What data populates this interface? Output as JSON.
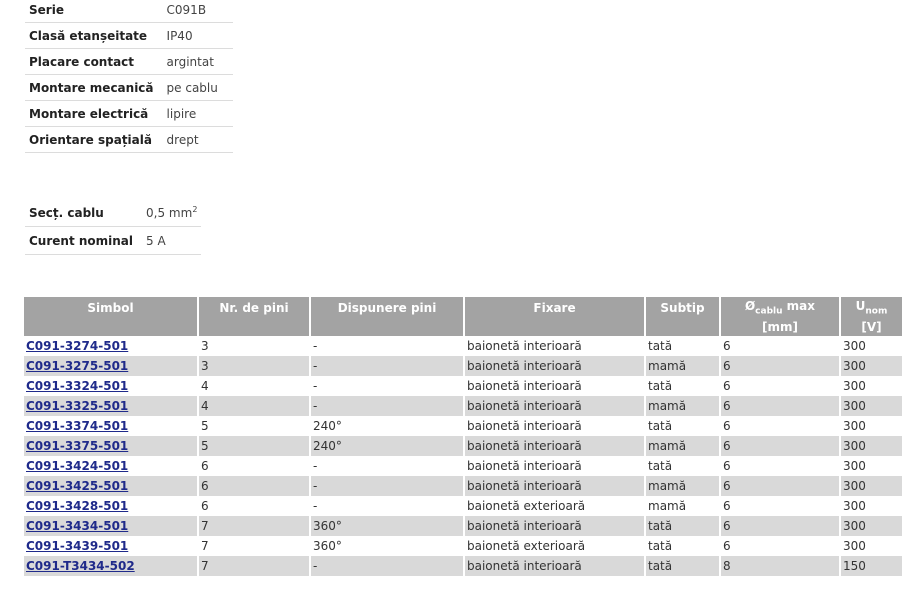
{
  "specs": [
    {
      "label": "Serie",
      "value": "C091B"
    },
    {
      "label": "Clasă etanșeitate",
      "value": "IP40"
    },
    {
      "label": "Placare contact",
      "value": "argintat"
    },
    {
      "label": "Montare mecanică",
      "value": "pe cablu"
    },
    {
      "label": "Montare electrică",
      "value": "lipire"
    },
    {
      "label": "Orientare spațială",
      "value": "drept"
    }
  ],
  "cable": {
    "section_label": "Secț. cablu",
    "section_value": "0,5 mm",
    "section_exp": "2",
    "current_label": "Curent nominal",
    "current_value": "5 A"
  },
  "table": {
    "headers": {
      "simbol": "Simbol",
      "pini": "Nr. de pini",
      "dispunere": "Dispunere pini",
      "fixare": "Fixare",
      "subtip": "Subtip",
      "diam_prefix": "Ø",
      "diam_sub": "cablu",
      "diam_suffix": " max",
      "u": "U",
      "u_sub": "nom"
    },
    "units": {
      "diam": "[mm]",
      "u": "[V]"
    },
    "rows": [
      {
        "simbol": "C091-3274-501",
        "pini": "3",
        "dispunere": "-",
        "fixare": "baionetă interioară",
        "subtip": "tată",
        "diam": "6",
        "u": "300"
      },
      {
        "simbol": "C091-3275-501",
        "pini": "3",
        "dispunere": "-",
        "fixare": "baionetă interioară",
        "subtip": "mamă",
        "diam": "6",
        "u": "300"
      },
      {
        "simbol": "C091-3324-501",
        "pini": "4",
        "dispunere": "-",
        "fixare": "baionetă interioară",
        "subtip": "tată",
        "diam": "6",
        "u": "300"
      },
      {
        "simbol": "C091-3325-501",
        "pini": "4",
        "dispunere": "-",
        "fixare": "baionetă interioară",
        "subtip": "mamă",
        "diam": "6",
        "u": "300"
      },
      {
        "simbol": "C091-3374-501",
        "pini": "5",
        "dispunere": "240°",
        "fixare": "baionetă interioară",
        "subtip": "tată",
        "diam": "6",
        "u": "300"
      },
      {
        "simbol": "C091-3375-501",
        "pini": "5",
        "dispunere": "240°",
        "fixare": "baionetă interioară",
        "subtip": "mamă",
        "diam": "6",
        "u": "300"
      },
      {
        "simbol": "C091-3424-501",
        "pini": "6",
        "dispunere": "-",
        "fixare": "baionetă interioară",
        "subtip": "tată",
        "diam": "6",
        "u": "300"
      },
      {
        "simbol": "C091-3425-501",
        "pini": "6",
        "dispunere": "-",
        "fixare": "baionetă interioară",
        "subtip": "mamă",
        "diam": "6",
        "u": "300"
      },
      {
        "simbol": "C091-3428-501",
        "pini": "6",
        "dispunere": "-",
        "fixare": "baionetă exterioară",
        "subtip": "mamă",
        "diam": "6",
        "u": "300"
      },
      {
        "simbol": "C091-3434-501",
        "pini": "7",
        "dispunere": "360°",
        "fixare": "baionetă interioară",
        "subtip": "tată",
        "diam": "6",
        "u": "300"
      },
      {
        "simbol": "C091-3439-501",
        "pini": "7",
        "dispunere": "360°",
        "fixare": "baionetă exterioară",
        "subtip": "tată",
        "diam": "6",
        "u": "300"
      },
      {
        "simbol": "C091-T3434-502",
        "pini": "7",
        "dispunere": "-",
        "fixare": "baionetă interioară",
        "subtip": "tată",
        "diam": "8",
        "u": "150"
      }
    ]
  }
}
